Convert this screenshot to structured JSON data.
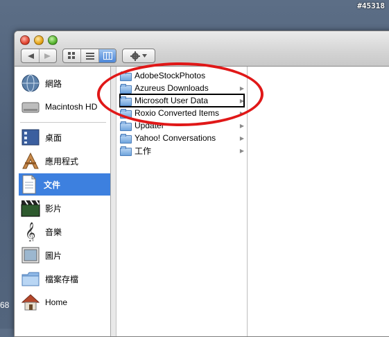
{
  "desktop": {
    "tag": "#45318",
    "left_number": "68"
  },
  "toolbar": {
    "back_icon": "left-arrow-icon",
    "forward_icon": "right-arrow-icon",
    "view_modes": [
      "icon-view",
      "list-view",
      "column-view"
    ],
    "action_icon": "gear-icon"
  },
  "sidebar": {
    "items": [
      {
        "label": "網路",
        "icon": "network-globe-icon"
      },
      {
        "label": "Macintosh HD",
        "icon": "hard-drive-icon"
      },
      {
        "label": "桌面",
        "icon": "desktop-icon"
      },
      {
        "label": "應用程式",
        "icon": "applications-icon"
      },
      {
        "label": "文件",
        "icon": "documents-icon",
        "selected": true
      },
      {
        "label": "影片",
        "icon": "movies-icon"
      },
      {
        "label": "音樂",
        "icon": "music-icon"
      },
      {
        "label": "圖片",
        "icon": "pictures-icon"
      },
      {
        "label": "檔案存檔",
        "icon": "archive-folder-icon"
      },
      {
        "label": "Home",
        "icon": "home-icon"
      }
    ]
  },
  "column1": {
    "rows": [
      {
        "label": "AdobeStockPhotos",
        "has_children": false
      },
      {
        "label": "Azureus Downloads",
        "has_children": true
      },
      {
        "label": "Microsoft User Data",
        "has_children": true,
        "highlighted": true
      },
      {
        "label": "Roxio Converted Items",
        "has_children": true
      },
      {
        "label": "Updater",
        "has_children": true
      },
      {
        "label": "Yahoo! Conversations",
        "has_children": true
      },
      {
        "label": "工作",
        "has_children": true
      }
    ]
  },
  "annotation_color": "#e01818"
}
